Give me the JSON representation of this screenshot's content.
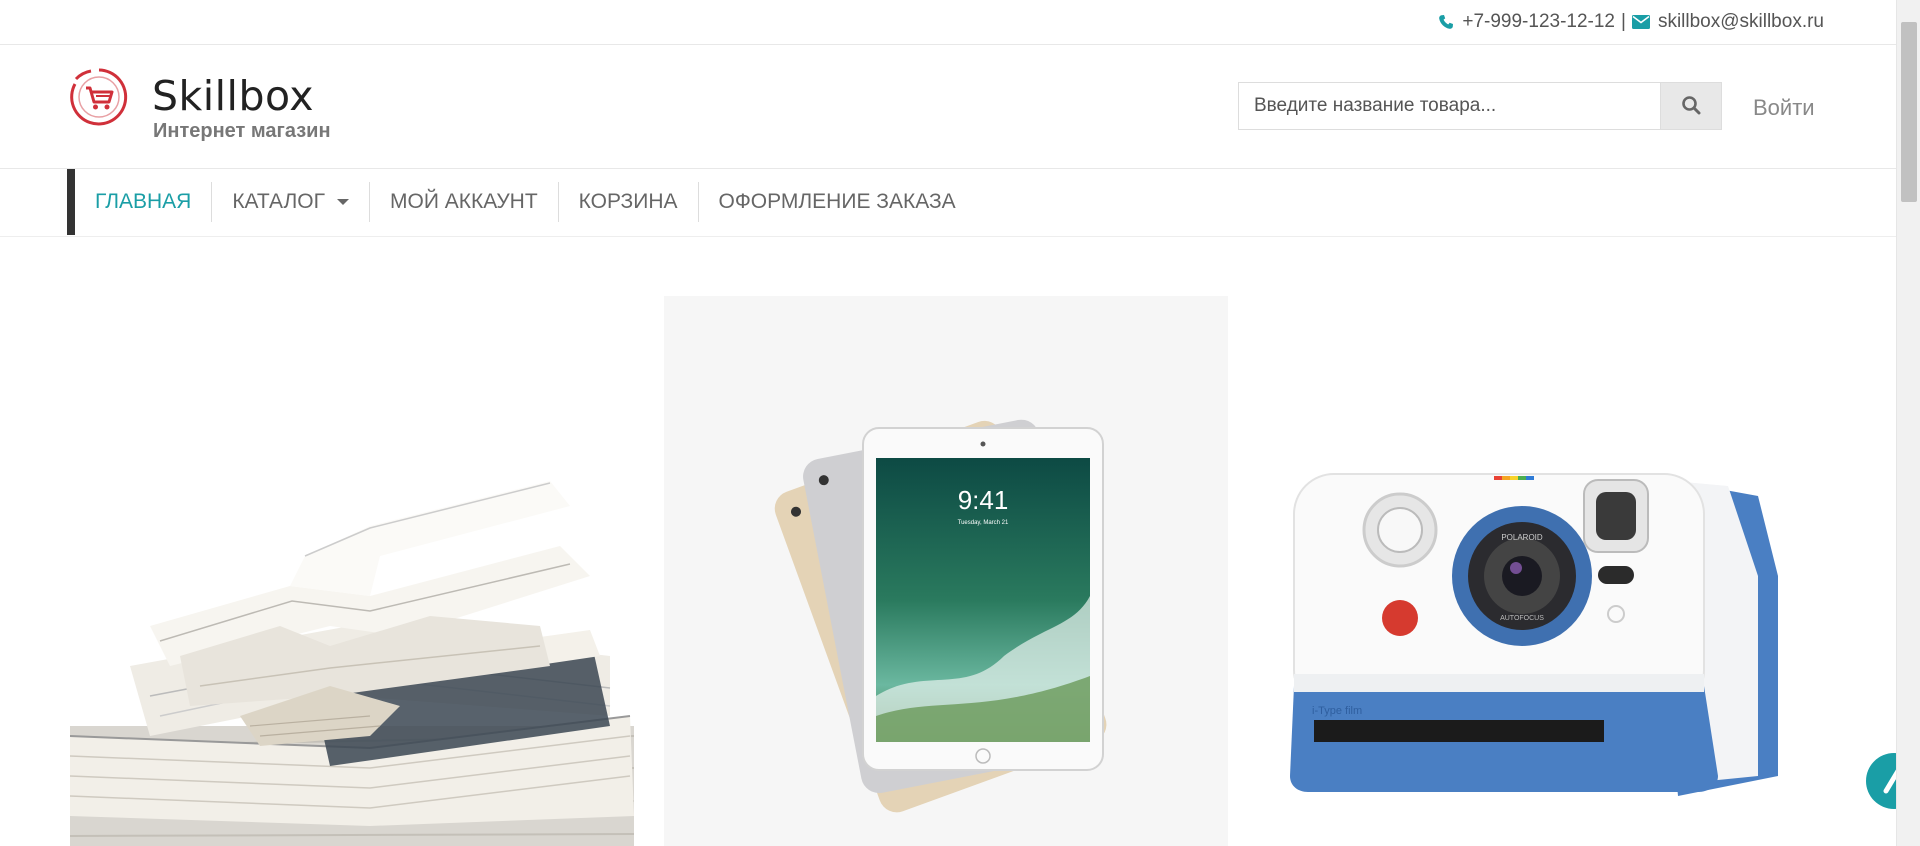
{
  "topbar": {
    "phone": "+7-999-123-12-12",
    "separator": "|",
    "email": "skillbox@skillbox.ru",
    "phone_icon": "phone-icon",
    "email_icon": "envelope-icon",
    "accent_color": "#1a9ea6"
  },
  "header": {
    "brand": "Skillbox",
    "tagline": "Интернет магазин",
    "logo_icon": "cart-logo-icon",
    "logo_color": "#d0303a",
    "search": {
      "placeholder": "Введите название товара...",
      "value": "",
      "button_icon": "search-icon"
    },
    "login_label": "Войти"
  },
  "nav": {
    "items": [
      {
        "label": "ГЛАВНАЯ",
        "active": true
      },
      {
        "label": "КАТАЛОГ",
        "dropdown": true
      },
      {
        "label": "МОЙ АККАУНТ"
      },
      {
        "label": "КОРЗИНА"
      },
      {
        "label": "ОФОРМЛЕНИЕ ЗАКАЗА"
      }
    ]
  },
  "products": [
    {
      "image": "books-image"
    },
    {
      "image": "ipad-image",
      "screen_time": "9:41",
      "screen_date": "Tuesday, March 21"
    },
    {
      "image": "polaroid-camera-image",
      "lens_text": "POLAROID",
      "autofocus_text": "AUTOFOCUS",
      "film_text": "i-Type film"
    }
  ]
}
